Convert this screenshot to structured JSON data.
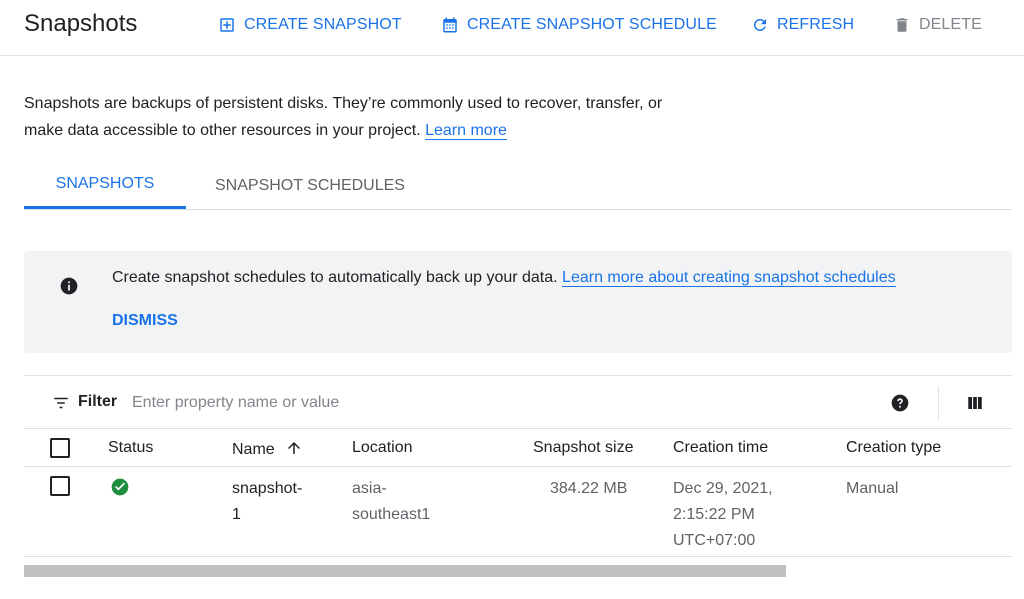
{
  "header": {
    "title": "Snapshots",
    "create_snapshot": "CREATE SNAPSHOT",
    "create_schedule": "CREATE SNAPSHOT SCHEDULE",
    "refresh": "REFRESH",
    "delete": "DELETE"
  },
  "description": {
    "text": "Snapshots are backups of persistent disks. They’re commonly used to recover, transfer, or make data accessible to other resources in your project.",
    "link": "Learn more"
  },
  "tabs": [
    {
      "label": "SNAPSHOTS",
      "active": true
    },
    {
      "label": "SNAPSHOT SCHEDULES",
      "active": false
    }
  ],
  "banner": {
    "message": "Create snapshot schedules to automatically back up your data.",
    "link": "Learn more about creating snapshot schedules",
    "dismiss": "DISMISS"
  },
  "filter": {
    "label": "Filter",
    "placeholder": "Enter property name or value"
  },
  "table": {
    "columns": [
      "Status",
      "Name",
      "Location",
      "Snapshot size",
      "Creation time",
      "Creation type"
    ],
    "rows": [
      {
        "status": "ok",
        "name_lines": [
          "snapshot-",
          "1"
        ],
        "location_lines": [
          "asia-",
          "southeast1"
        ],
        "size": "384.22 MB",
        "time_lines": [
          "Dec 29, 2021,",
          "2:15:22 PM",
          "UTC+07:00"
        ],
        "type": "Manual"
      }
    ]
  },
  "colors": {
    "accent": "#1a73e8",
    "success": "#1e8e3e",
    "banner_bg": "#f1f3f4"
  },
  "icons": {
    "create": "add-box-icon",
    "schedule": "calendar-icon",
    "refresh": "refresh-icon",
    "delete": "trash-icon",
    "info": "info-icon",
    "filter": "filter-icon",
    "help": "help-icon",
    "columns": "columns-icon",
    "sort": "arrow-up-icon",
    "status": "check-circle-icon"
  }
}
